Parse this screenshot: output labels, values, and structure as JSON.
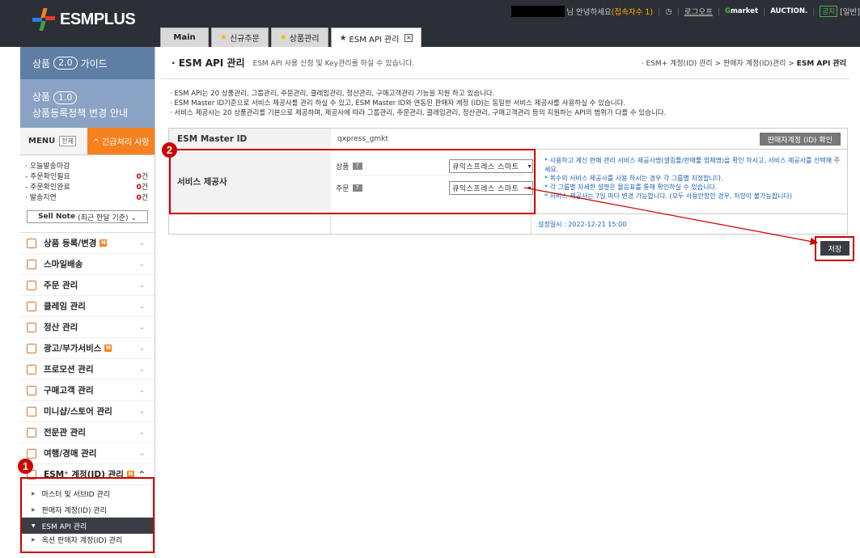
{
  "header": {
    "logo_text": "ESMPLUS",
    "greeting": "님 안녕하세요",
    "connection": "(접속자수 1)",
    "clock_icon": "clock-icon",
    "logout": "로그오프",
    "gmarket": "market",
    "gmarket_g": "G",
    "auction": "AUCTION.",
    "notice": "공지",
    "general": "[일반]"
  },
  "tabs": [
    {
      "label": "Main"
    },
    {
      "label": "신규주문"
    },
    {
      "label": "상품관리"
    },
    {
      "label": "ESM API 관리"
    }
  ],
  "sidebar": {
    "guide1_prefix": "상품",
    "guide1_pill": "2.0",
    "guide1_suffix": "가이드",
    "guide2_prefix": "상품",
    "guide2_pill": "1.0",
    "guide2_line2": "상품등록정책 변경 안내",
    "menu_label": "MENU",
    "menu_all": "전체",
    "urgent": "^ 긴급처리 사항",
    "ship_title": "· 오늘발송마감",
    "ship_rows": [
      {
        "label": "- 주문확인필요",
        "count": "0",
        "unit": "건"
      },
      {
        "label": "- 주문확인완료",
        "count": "0",
        "unit": "건"
      },
      {
        "label": "· 발송지연",
        "count": "0",
        "unit": "건"
      }
    ],
    "sellnote_bold": "Sell Note",
    "sellnote_rest": "(최근 한달 기준) ⌄",
    "items": [
      {
        "label": "상품 등록/변경",
        "badge": "N"
      },
      {
        "label": "스마일배송",
        "badge": ""
      },
      {
        "label": "주문 관리",
        "badge": ""
      },
      {
        "label": "클레임 관리",
        "badge": ""
      },
      {
        "label": "정산 관리",
        "badge": ""
      },
      {
        "label": "광고/부가서비스",
        "badge": "N"
      },
      {
        "label": "프로모션 관리",
        "badge": ""
      },
      {
        "label": "구매고객 관리",
        "badge": ""
      },
      {
        "label": "미니샵/스토어 관리",
        "badge": ""
      },
      {
        "label": "전문관 관리",
        "badge": ""
      },
      {
        "label": "여행/경매 관리",
        "badge": ""
      }
    ],
    "esm_item": {
      "label": "ESM⁺ 계정(ID) 관리",
      "badge": "N"
    },
    "sub_items": [
      {
        "label": "마스터 및 서브ID 관리"
      },
      {
        "label": "판매자 계정(ID) 관리"
      },
      {
        "label": "ESM API 관리"
      },
      {
        "label": "옥션 판매자 계정(ID) 관리"
      }
    ]
  },
  "page": {
    "title": "· ESM API 관리",
    "desc": "ESM API 사용 신청 및 Key관리를 하실 수 있습니다.",
    "breadcrumb_prefix": "· ESM+ 계정(ID) 관리 > 판매자 계정(ID)관리 >",
    "breadcrumb_current": "ESM API 관리",
    "notes": [
      "· ESM API는 20 상품관리, 그룹관리, 주문관리, 클레임관리, 정산관리, 구매고객관리 기능을 지원 하고 있습니다.",
      "· ESM Master ID기준으로 서비스 제공사를 관리 하실 수 있고, ESM Master ID와 연동된 판매자 계정 (ID)는 동일한 서비스 제공사를 사용하실 수 있습니다.",
      "· 서비스 제공사는 20 상품관리를 기본으로 제공하며, 제공사에 따라 그룹관리, 주문관리, 클레임관리, 정산관리, 구매고객관리 등의 지원하는 API의 범위가 다를 수 있습니다."
    ],
    "master_label": "ESM Master ID",
    "master_value": "qxpress_gmkt",
    "check_button": "판매자계정 (ID) 확인",
    "provider_label": "서비스 제공사",
    "rows": [
      {
        "label": "상품",
        "select_value": "큐익스프레스 스마트"
      },
      {
        "label": "주문",
        "select_value": "큐익스프레스 스마트"
      }
    ],
    "info": [
      "* 사용하고 계신 판매 관리 서비스 제공사명(셀링툴/판매툴 업체명)을 확인 하시고, 서비스 제공사를 선택해 주세요.",
      "* 복수의 서비스 제공사를 사용 하시는 경우 각 그룹별 지정합니다.",
      "* 각 그룹별 자세한 설명은 물음표를 통해 확인하실 수 있습니다.",
      "* 서비스 제공사는 7일 마다 변경 가능합니다. (모두 사용안함인 경우, 저장이 불가능합니다)"
    ],
    "set_date": "설정일시 : 2022-12-21 15:00",
    "save_button": "저장"
  },
  "annotations": [
    {
      "label": "1"
    },
    {
      "label": "2"
    }
  ]
}
